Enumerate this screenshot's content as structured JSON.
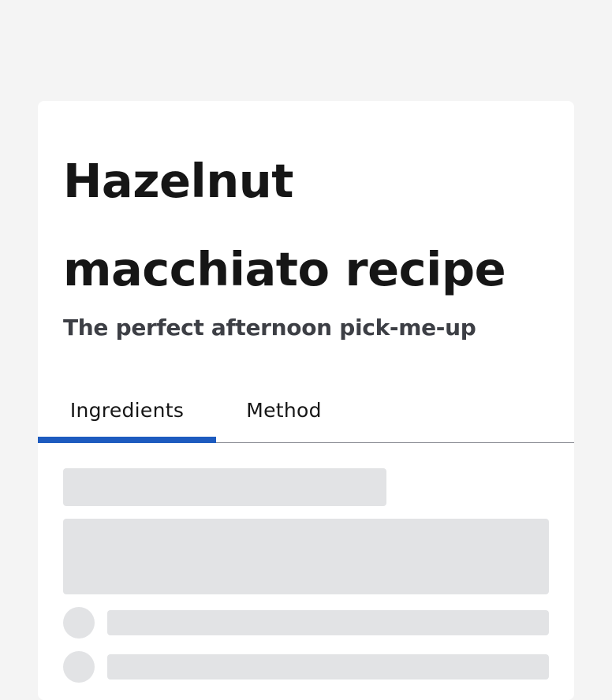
{
  "recipe": {
    "title": "Hazelnut macchiato recipe",
    "subtitle": "The perfect afternoon pick-me-up"
  },
  "tabs": [
    {
      "label": "Ingredients",
      "selected": true
    },
    {
      "label": "Method",
      "selected": false
    }
  ],
  "colors": {
    "page_background": "#f4f4f4",
    "card_background": "#ffffff",
    "active_tab_indicator": "#1d5bbf",
    "skeleton_placeholder": "#e2e3e5",
    "title_text": "#161616",
    "subtitle_text": "#3d3f45"
  },
  "content_state": "loading-skeleton"
}
